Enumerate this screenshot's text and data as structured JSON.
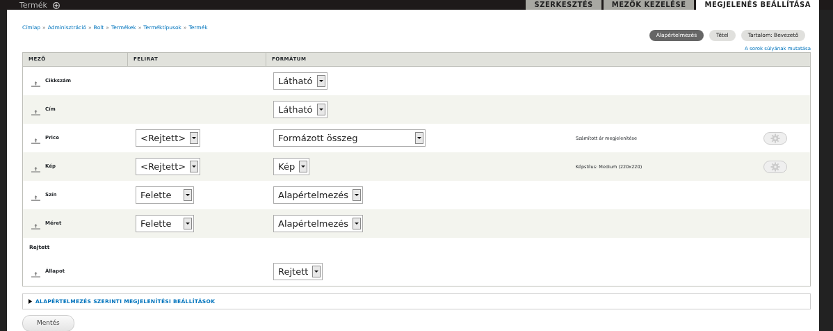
{
  "header": {
    "title": "Termék",
    "tabs": [
      {
        "label": "SZERKESZTÉS",
        "selected": false
      },
      {
        "label": "MEZŐK KEZELÉSE",
        "selected": false
      },
      {
        "label": "MEGJELENÉS BEÁLLÍTÁSA",
        "selected": true
      }
    ]
  },
  "breadcrumb": {
    "separator": "»",
    "items": [
      "Címlap",
      "Adminisztráció",
      "Bolt",
      "Termékek",
      "Terméktípusok",
      "Termék"
    ]
  },
  "view_modes": [
    {
      "label": "Alapértelmezés",
      "selected": true
    },
    {
      "label": "Tétel",
      "selected": false
    },
    {
      "label": "Tartalom: Bevezető",
      "selected": false
    }
  ],
  "weights_link": "A sorok súlyának mutatása",
  "table": {
    "columns": [
      "MEZŐ",
      "FELIRAT",
      "FORMÁTUM"
    ],
    "rows": [
      {
        "kind": "field",
        "name": "Cikkszám",
        "format": "Látható"
      },
      {
        "kind": "field",
        "name": "Cím",
        "format": "Látható"
      },
      {
        "kind": "field",
        "name": "Price",
        "label": "<Rejtett>",
        "format": "Formázott összeg",
        "summary": "Számított ár megjelenítése",
        "settings": true
      },
      {
        "kind": "field",
        "name": "Kép",
        "label": "<Rejtett>",
        "format": "Kép",
        "summary": "Képstílus: Medium (220x220)",
        "settings": true
      },
      {
        "kind": "field",
        "name": "Szín",
        "label": "Felette",
        "format": "Alapértelmezés"
      },
      {
        "kind": "field",
        "name": "Méret",
        "label": "Felette",
        "format": "Alapértelmezés"
      },
      {
        "kind": "region",
        "name": "Rejtett"
      },
      {
        "kind": "field",
        "name": "Állapot",
        "format": "Rejtett"
      }
    ]
  },
  "fieldset": {
    "title": "ALAPÉRTELMEZÉS SZERINTI MEGJELENÍTÉSI BEÁLLÍTÁSOK",
    "expanded": false
  },
  "save_button": "Mentés"
}
